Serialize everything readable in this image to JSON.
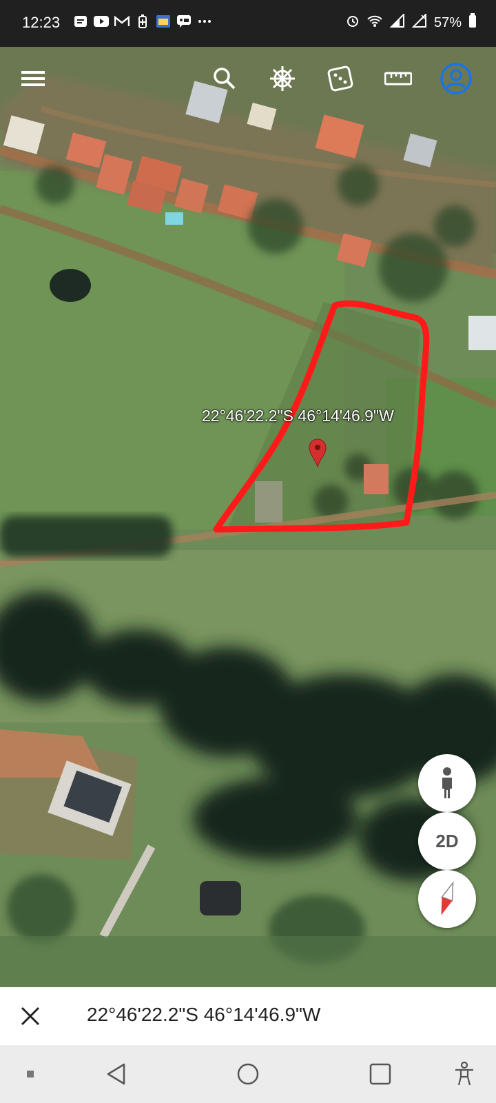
{
  "status_bar": {
    "time": "12:23",
    "left_icons": [
      "notes-icon",
      "youtube-icon",
      "gmail-icon",
      "battery-saver-icon",
      "app-icon",
      "chat-icon",
      "more-dots-icon"
    ],
    "right_icons": [
      "alarm-icon",
      "wifi-icon",
      "signal-icon",
      "signal-icon-2"
    ],
    "battery": "57%"
  },
  "toolbar": {
    "icons": [
      "menu-icon",
      "search-icon",
      "voyager-wheel-icon",
      "dice-icon",
      "ruler-icon",
      "account-icon"
    ]
  },
  "map": {
    "coordinate_label": "22°46'22.2\"S 46°14'46.9\"W",
    "pin_color": "#d32f2f",
    "outline_color": "#ff1a1a",
    "controls": {
      "street_view": "person-icon",
      "view_mode": "2D",
      "compass": "compass-icon"
    }
  },
  "bottom_sheet": {
    "close": "close-icon",
    "coordinates": "22°46'22.2\"S 46°14'46.9\"W"
  },
  "nav_bar": {
    "icons": [
      "square-dot-icon",
      "back-icon",
      "home-icon",
      "recents-icon",
      "accessibility-icon"
    ]
  }
}
